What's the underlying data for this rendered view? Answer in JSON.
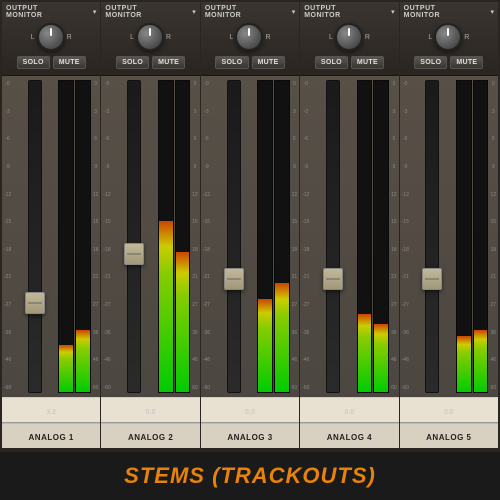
{
  "channels": [
    {
      "id": "analog1",
      "header_line1": "OUTPUT",
      "header_line2": "MONITOR",
      "solo_label": "SOLO",
      "mute_label": "MUTE",
      "lr_left": "L",
      "lr_right": "R",
      "fader_position_pct": 68,
      "meter_left_pct": 15,
      "meter_right_pct": 20,
      "value": "3.2",
      "name": "ANALOG 1",
      "scale": [
        "0",
        "3",
        "6",
        "9",
        "12",
        "15",
        "18",
        "21",
        "27",
        "36",
        "46",
        "60"
      ]
    },
    {
      "id": "analog2",
      "header_line1": "OUTPUT",
      "header_line2": "MONITOR",
      "solo_label": "SOLO",
      "mute_label": "MUTE",
      "lr_left": "L",
      "lr_right": "R",
      "fader_position_pct": 52,
      "meter_left_pct": 55,
      "meter_right_pct": 45,
      "value": "0.0",
      "name": "ANALOG 2",
      "scale": [
        "0",
        "3",
        "6",
        "9",
        "12",
        "15",
        "18",
        "21",
        "27",
        "36",
        "46",
        "60"
      ]
    },
    {
      "id": "analog3",
      "header_line1": "OUTPUT",
      "header_line2": "MONITOR",
      "solo_label": "SOLO",
      "mute_label": "MUTE",
      "lr_left": "L",
      "lr_right": "R",
      "fader_position_pct": 60,
      "meter_left_pct": 30,
      "meter_right_pct": 35,
      "value": "0.0",
      "name": "ANALOG 3",
      "scale": [
        "0",
        "3",
        "6",
        "9",
        "12",
        "15",
        "18",
        "21",
        "27",
        "36",
        "46",
        "60"
      ]
    },
    {
      "id": "analog4",
      "header_line1": "OUTPUT",
      "header_line2": "MONITOR",
      "solo_label": "SOLO",
      "mute_label": "MUTE",
      "lr_left": "L",
      "lr_right": "R",
      "fader_position_pct": 60,
      "meter_left_pct": 25,
      "meter_right_pct": 22,
      "value": "0.0",
      "name": "ANALOG 4",
      "scale": [
        "0",
        "3",
        "6",
        "9",
        "12",
        "15",
        "18",
        "21",
        "27",
        "36",
        "46",
        "60"
      ]
    },
    {
      "id": "analog5",
      "header_line1": "OUTPUT",
      "header_line2": "MONITOR",
      "solo_label": "SOLO",
      "mute_label": "MUTE",
      "lr_left": "L",
      "lr_right": "R",
      "fader_position_pct": 60,
      "meter_left_pct": 18,
      "meter_right_pct": 20,
      "value": "0.0",
      "name": "ANALOG 5",
      "scale": [
        "0",
        "3",
        "6",
        "9",
        "12",
        "15",
        "18",
        "21",
        "27",
        "36",
        "46",
        "60"
      ]
    }
  ],
  "bottom_label": "STEMS (TRACKOUTS)"
}
